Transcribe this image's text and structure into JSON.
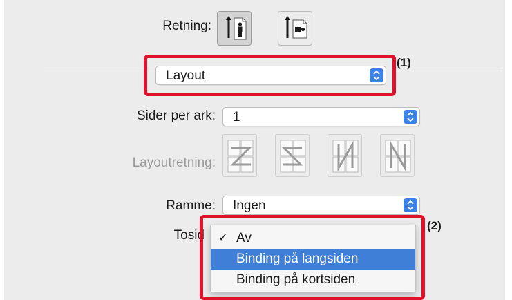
{
  "orientation": {
    "label": "Retning:",
    "options": [
      {
        "name": "portrait",
        "icon": "portrait-orientation-icon",
        "selected": true
      },
      {
        "name": "landscape",
        "icon": "landscape-orientation-icon",
        "selected": false
      }
    ]
  },
  "section_popup": {
    "value": "Layout"
  },
  "pages_per_sheet": {
    "label": "Sider per ark:",
    "value": "1"
  },
  "layout_direction": {
    "label": "Layoutretning:",
    "options": [
      "z-left-right-icon",
      "s-right-left-icon",
      "n-top-down-left-icon",
      "n-top-down-right-icon"
    ]
  },
  "border": {
    "label": "Ramme:",
    "value": "Ingen"
  },
  "two_sided": {
    "label": "Tosid",
    "menu": [
      {
        "label": "Av",
        "checked": true,
        "highlighted": false
      },
      {
        "label": "Binding på langsiden",
        "checked": false,
        "highlighted": true
      },
      {
        "label": "Binding på kortsiden",
        "checked": false,
        "highlighted": false
      }
    ]
  },
  "callouts": {
    "first": "(1)",
    "second": "(2)"
  },
  "colors": {
    "highlight": "#e0112b",
    "selection": "#3f7fd8",
    "accent": "#3c82e6"
  }
}
